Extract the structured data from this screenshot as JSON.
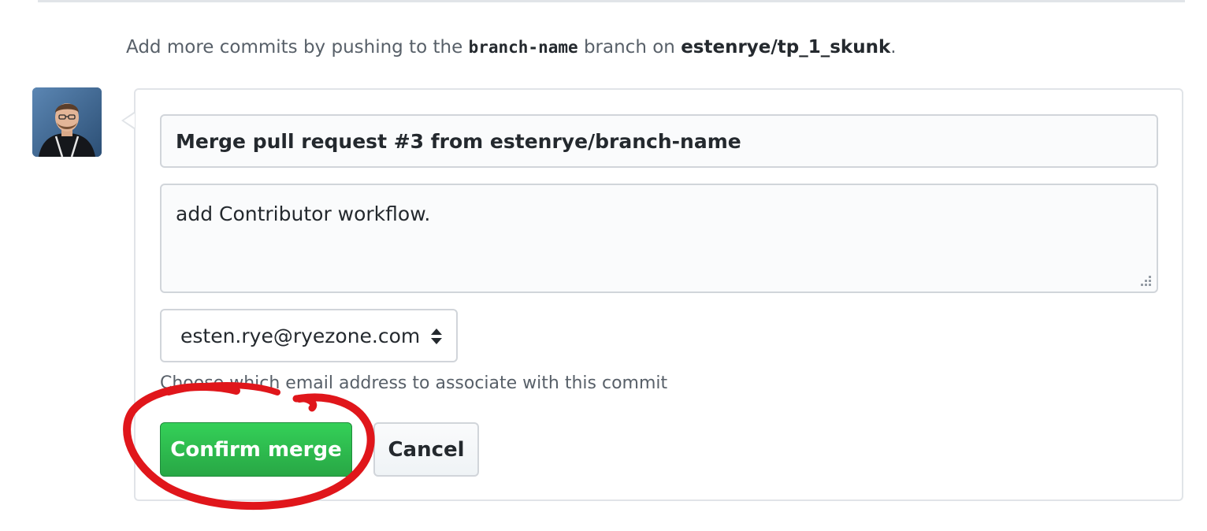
{
  "hint": {
    "prefix": "Add more commits by pushing to the ",
    "branch": "branch-name",
    "middle": " branch on ",
    "repo": "estenrye/tp_1_skunk",
    "suffix": "."
  },
  "merge_form": {
    "title_value": "Merge pull request #3 from estenrye/branch-name",
    "body_value": "add Contributor workflow.",
    "email_selected": "esten.rye@ryezone.com",
    "email_note": "Choose which email address to associate with this commit",
    "confirm_label": "Confirm merge",
    "cancel_label": "Cancel"
  },
  "colors": {
    "confirm_green": "#2ea44f",
    "annotation_red": "#e0161b"
  },
  "icons": {
    "select": "select-arrows-icon",
    "resize": "resize-grip-icon"
  }
}
